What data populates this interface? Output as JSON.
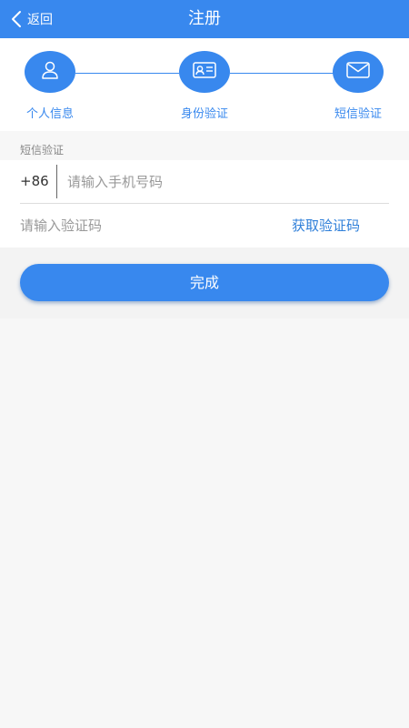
{
  "header": {
    "back_label": "返回",
    "title": "注册"
  },
  "steps": [
    {
      "label": "个人信息",
      "icon": "user-icon"
    },
    {
      "label": "身份验证",
      "icon": "id-card-icon"
    },
    {
      "label": "短信验证",
      "icon": "envelope-icon"
    }
  ],
  "sms_section": {
    "label": "短信验证",
    "country_code": "+86",
    "phone_placeholder": "请输入手机号码",
    "code_placeholder": "请输入验证码",
    "get_code_label": "获取验证码"
  },
  "submit_label": "完成",
  "colors": {
    "accent": "#3888ee",
    "link": "#2f7fd9",
    "background": "#f7f7f7"
  }
}
